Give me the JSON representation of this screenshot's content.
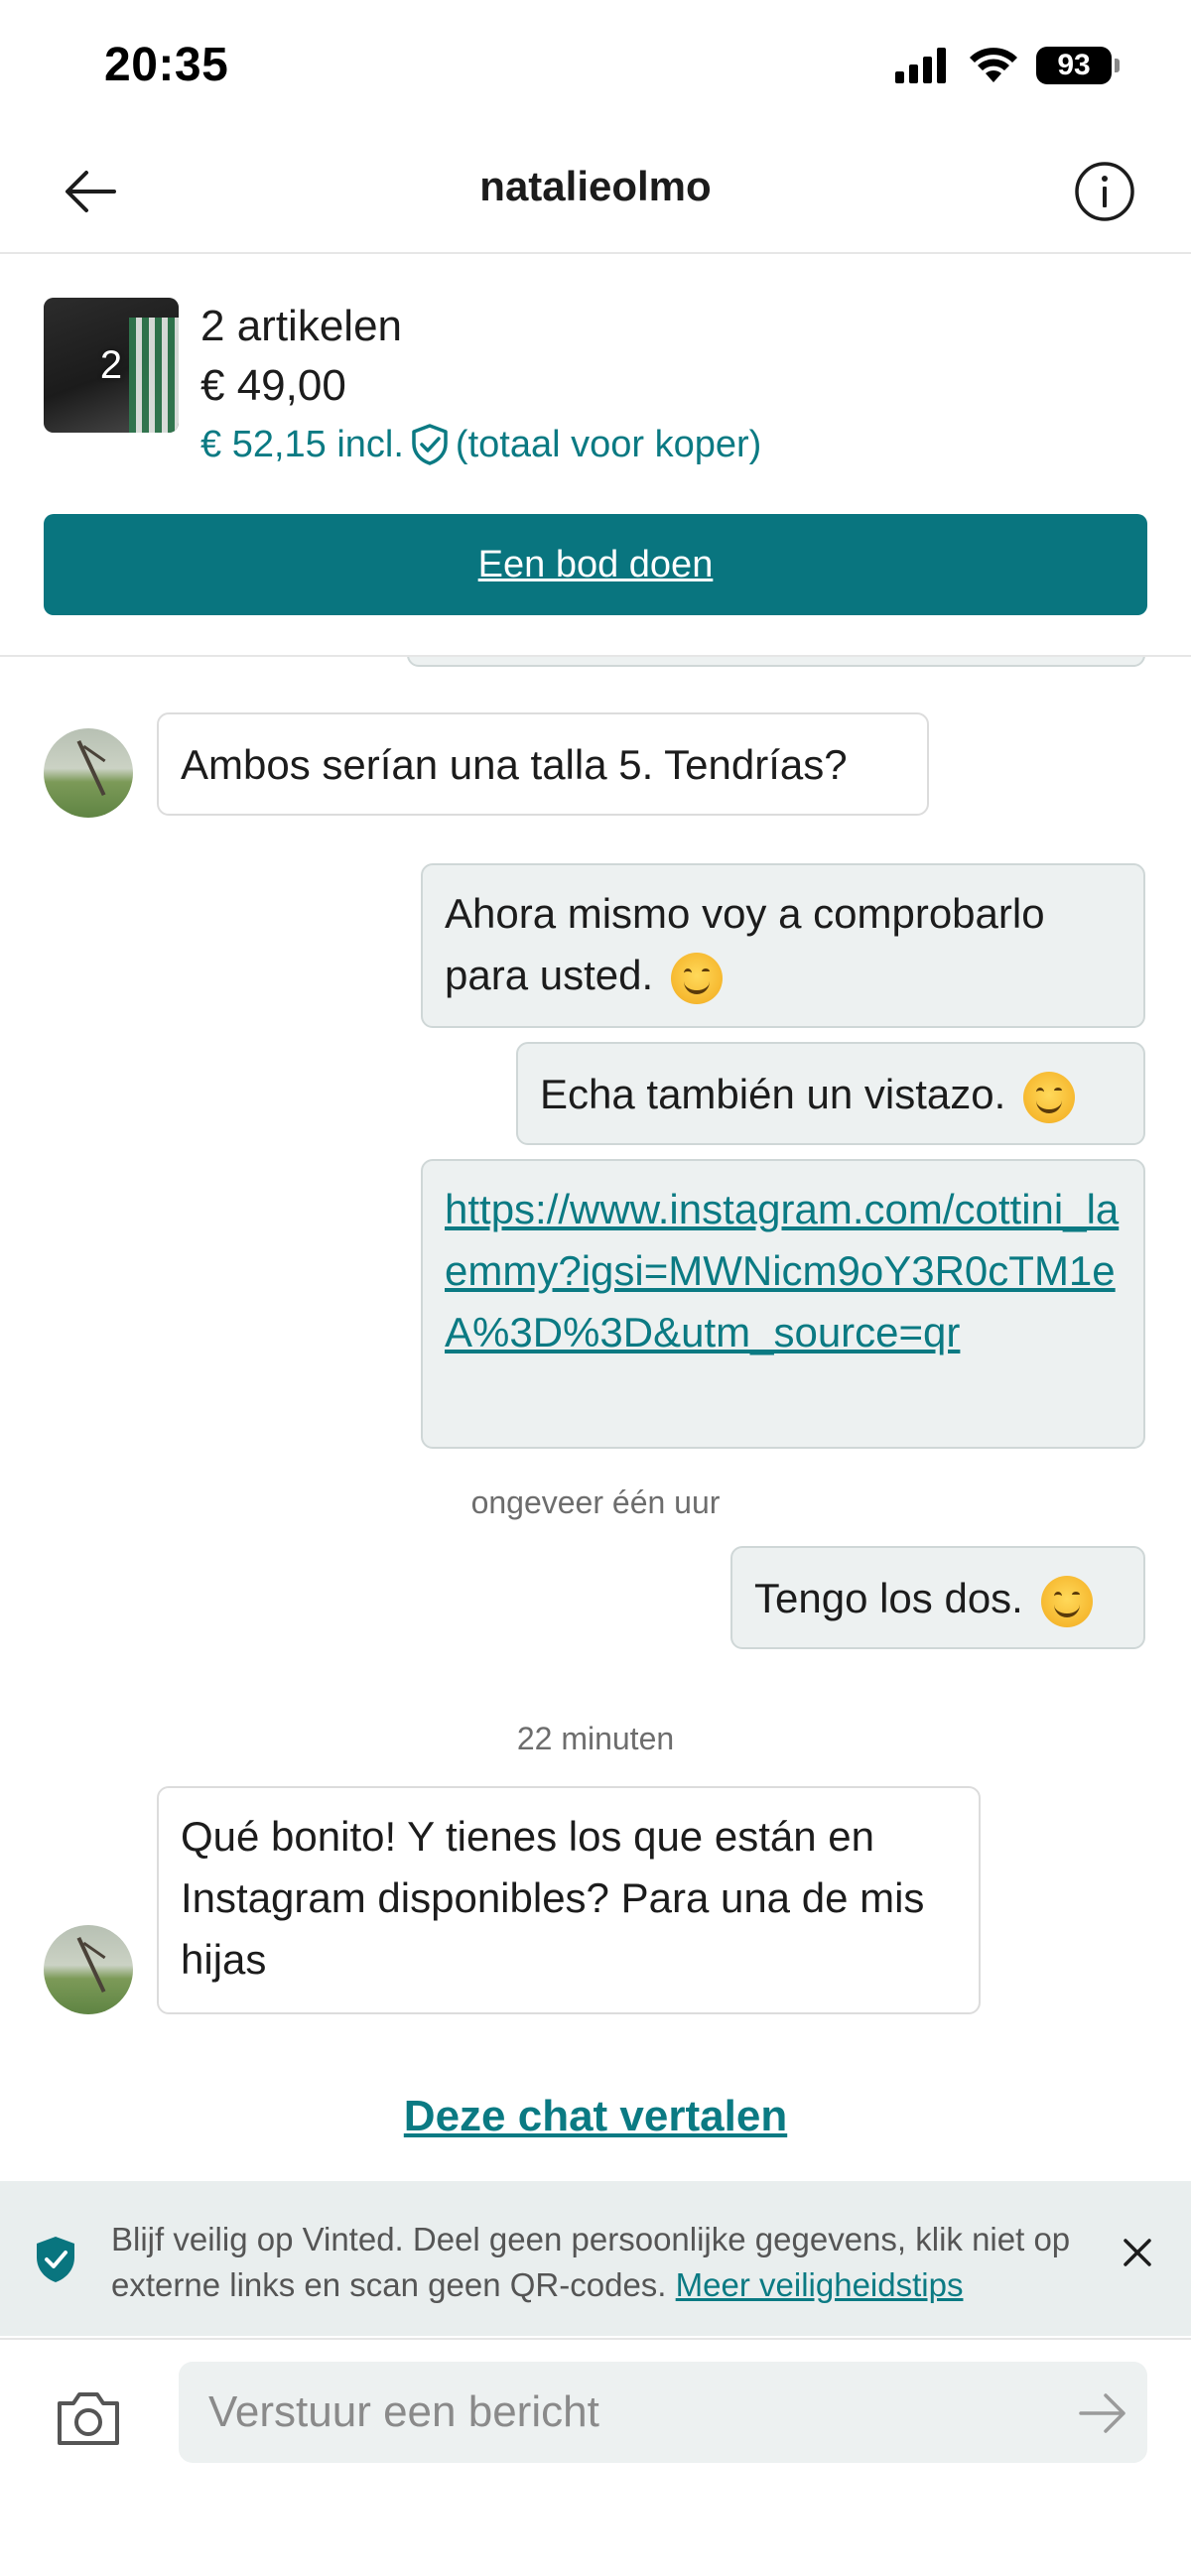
{
  "status_bar": {
    "time": "20:35",
    "battery": "93"
  },
  "header": {
    "title": "natalieolmo"
  },
  "item": {
    "thumb_count": "2",
    "count_label": "2 artikelen",
    "price": "€ 49,00",
    "total_prefix": "€ 52,15 incl.",
    "total_suffix": "(totaal voor koper)",
    "offer_button": "Een bod doen"
  },
  "messages": [
    {
      "side": "in",
      "text": "Ambos serían una talla 5. Tendrías?"
    },
    {
      "side": "out",
      "text": "Ahora mismo voy a comprobarlo para usted.",
      "emoji": "smiling-face-emoji"
    },
    {
      "side": "out",
      "text": "Echa también un vistazo.",
      "emoji": "smiling-face-emoji"
    },
    {
      "side": "out",
      "link": "https://www.instagram.com/cottini_laemmy?igsi=MWNicm9oY3R0cTM1eA%3D%3D&utm_source=qr"
    },
    {
      "timestamp": "ongeveer één uur"
    },
    {
      "side": "out",
      "text": "Tengo los dos.",
      "emoji": "smiling-face-emoji"
    },
    {
      "timestamp": "22 minuten"
    },
    {
      "side": "in",
      "text": "Qué bonito! Y tienes los que están en Instagram disponibles? Para una de mis hijas"
    }
  ],
  "translate_link": "Deze chat vertalen",
  "safety": {
    "text": "Blijf veilig op Vinted. Deel geen persoonlijke gegevens, klik niet op externe links en scan geen QR-codes.",
    "link": "Meer veiligheidstips"
  },
  "composer": {
    "placeholder": "Verstuur een bericht"
  },
  "colors": {
    "accent": "#09757f",
    "link": "#0b7a83",
    "outgoing_bubble": "#edf1f1"
  }
}
